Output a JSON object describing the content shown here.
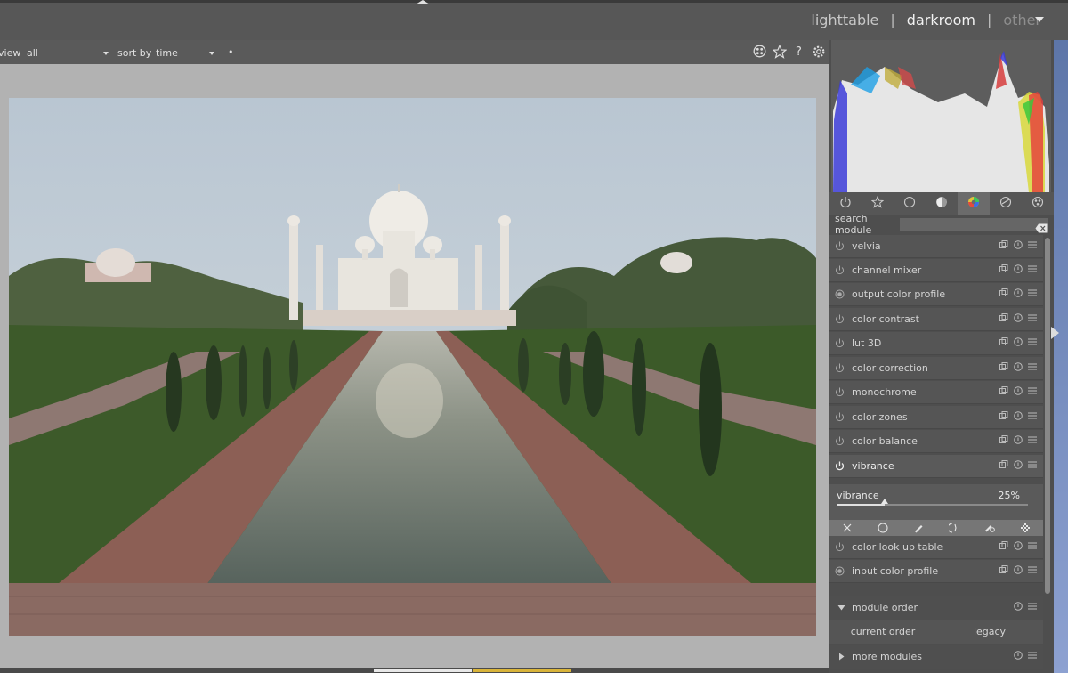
{
  "header": {
    "views": [
      "lighttable",
      "darkroom",
      "other"
    ],
    "active_view": "darkroom",
    "separator": "|"
  },
  "filterbar": {
    "view_label": "view",
    "view_value": "all",
    "sort_label": "sort by",
    "sort_value": "time",
    "dot": "•",
    "icons": [
      "grouping-icon",
      "star-icon",
      "help-icon",
      "settings-icon"
    ]
  },
  "image": {
    "subject": "Taj Mahal with reflecting pool"
  },
  "search": {
    "label": "search module",
    "value": ""
  },
  "module_groups": [
    "active-modules",
    "favorites",
    "base",
    "tone",
    "color",
    "correct",
    "effect"
  ],
  "active_group": "color",
  "modules_top": [
    {
      "name": "velvia",
      "enabled": false
    },
    {
      "name": "channel mixer",
      "enabled": false
    },
    {
      "name": "output color profile",
      "enabled": true
    },
    {
      "name": "color contrast",
      "enabled": false
    },
    {
      "name": "lut 3D",
      "enabled": false
    },
    {
      "name": "color correction",
      "enabled": false
    },
    {
      "name": "monochrome",
      "enabled": false
    },
    {
      "name": "color zones",
      "enabled": false
    },
    {
      "name": "color balance",
      "enabled": false
    },
    {
      "name": "vibrance",
      "enabled": true
    }
  ],
  "vibrance_param": {
    "label": "vibrance",
    "value_text": "25%",
    "fraction": 0.25
  },
  "blend_icons": [
    "off-icon",
    "uniform-icon",
    "drawn-mask-icon",
    "parametric-mask-icon",
    "drawn-parametric-icon",
    "raster-mask-icon"
  ],
  "modules_bottom": [
    {
      "name": "color look up table",
      "enabled": false
    },
    {
      "name": "input color profile",
      "enabled": true
    }
  ],
  "module_order": {
    "label": "module order",
    "buttons": [
      "current order",
      "legacy"
    ]
  },
  "more_modules": {
    "label": "more modules"
  },
  "colors": {
    "panel_bg": "#4e4e4e",
    "center_bg": "#b2b2b2",
    "text": "#d4d4d4",
    "accent_active": "#6b6b6b"
  }
}
